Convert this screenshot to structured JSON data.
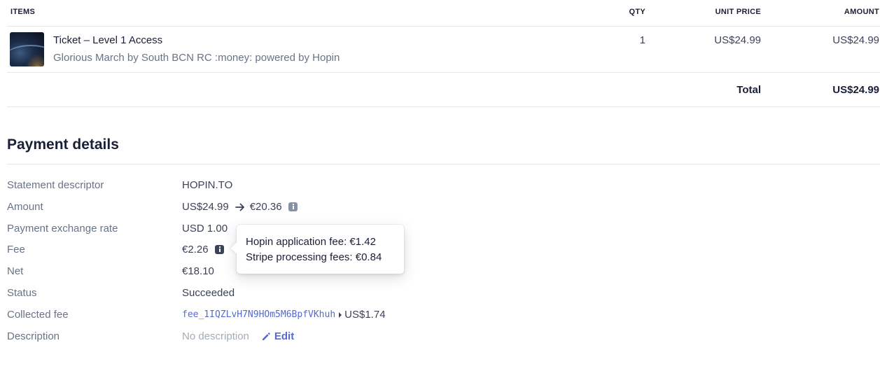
{
  "items_table": {
    "headers": {
      "items": "ITEMS",
      "qty": "QTY",
      "unit_price": "UNIT PRICE",
      "amount": "AMOUNT"
    },
    "rows": [
      {
        "name": "Ticket – Level 1 Access",
        "subtitle": "Glorious March by South BCN RC :money: powered by Hopin",
        "qty": "1",
        "unit_price": "US$24.99",
        "amount": "US$24.99"
      }
    ],
    "total_label": "Total",
    "total_value": "US$24.99"
  },
  "payment_details": {
    "title": "Payment details",
    "statement_descriptor": {
      "label": "Statement descriptor",
      "value": "HOPIN.TO"
    },
    "amount": {
      "label": "Amount",
      "value": "US$24.99",
      "converted": "€20.36"
    },
    "exchange_rate": {
      "label": "Payment exchange rate",
      "value": "USD 1.00"
    },
    "fee": {
      "label": "Fee",
      "value": "€2.26"
    },
    "net": {
      "label": "Net",
      "value": "€18.10"
    },
    "status": {
      "label": "Status",
      "value": "Succeeded"
    },
    "collected_fee": {
      "label": "Collected fee",
      "link": "fee_1IQZLvH7N9HOm5M6BpfVKhuh",
      "value": "US$1.74"
    },
    "description": {
      "label": "Description",
      "value": "No description",
      "edit_label": "Edit"
    }
  },
  "tooltip": {
    "line1": "Hopin application fee: €1.42",
    "line2": "Stripe processing fees: €0.84"
  },
  "colors": {
    "accent": "#5469d4",
    "text_primary": "#1a1f36",
    "text_secondary": "#697386",
    "border": "#e3e8ee"
  }
}
